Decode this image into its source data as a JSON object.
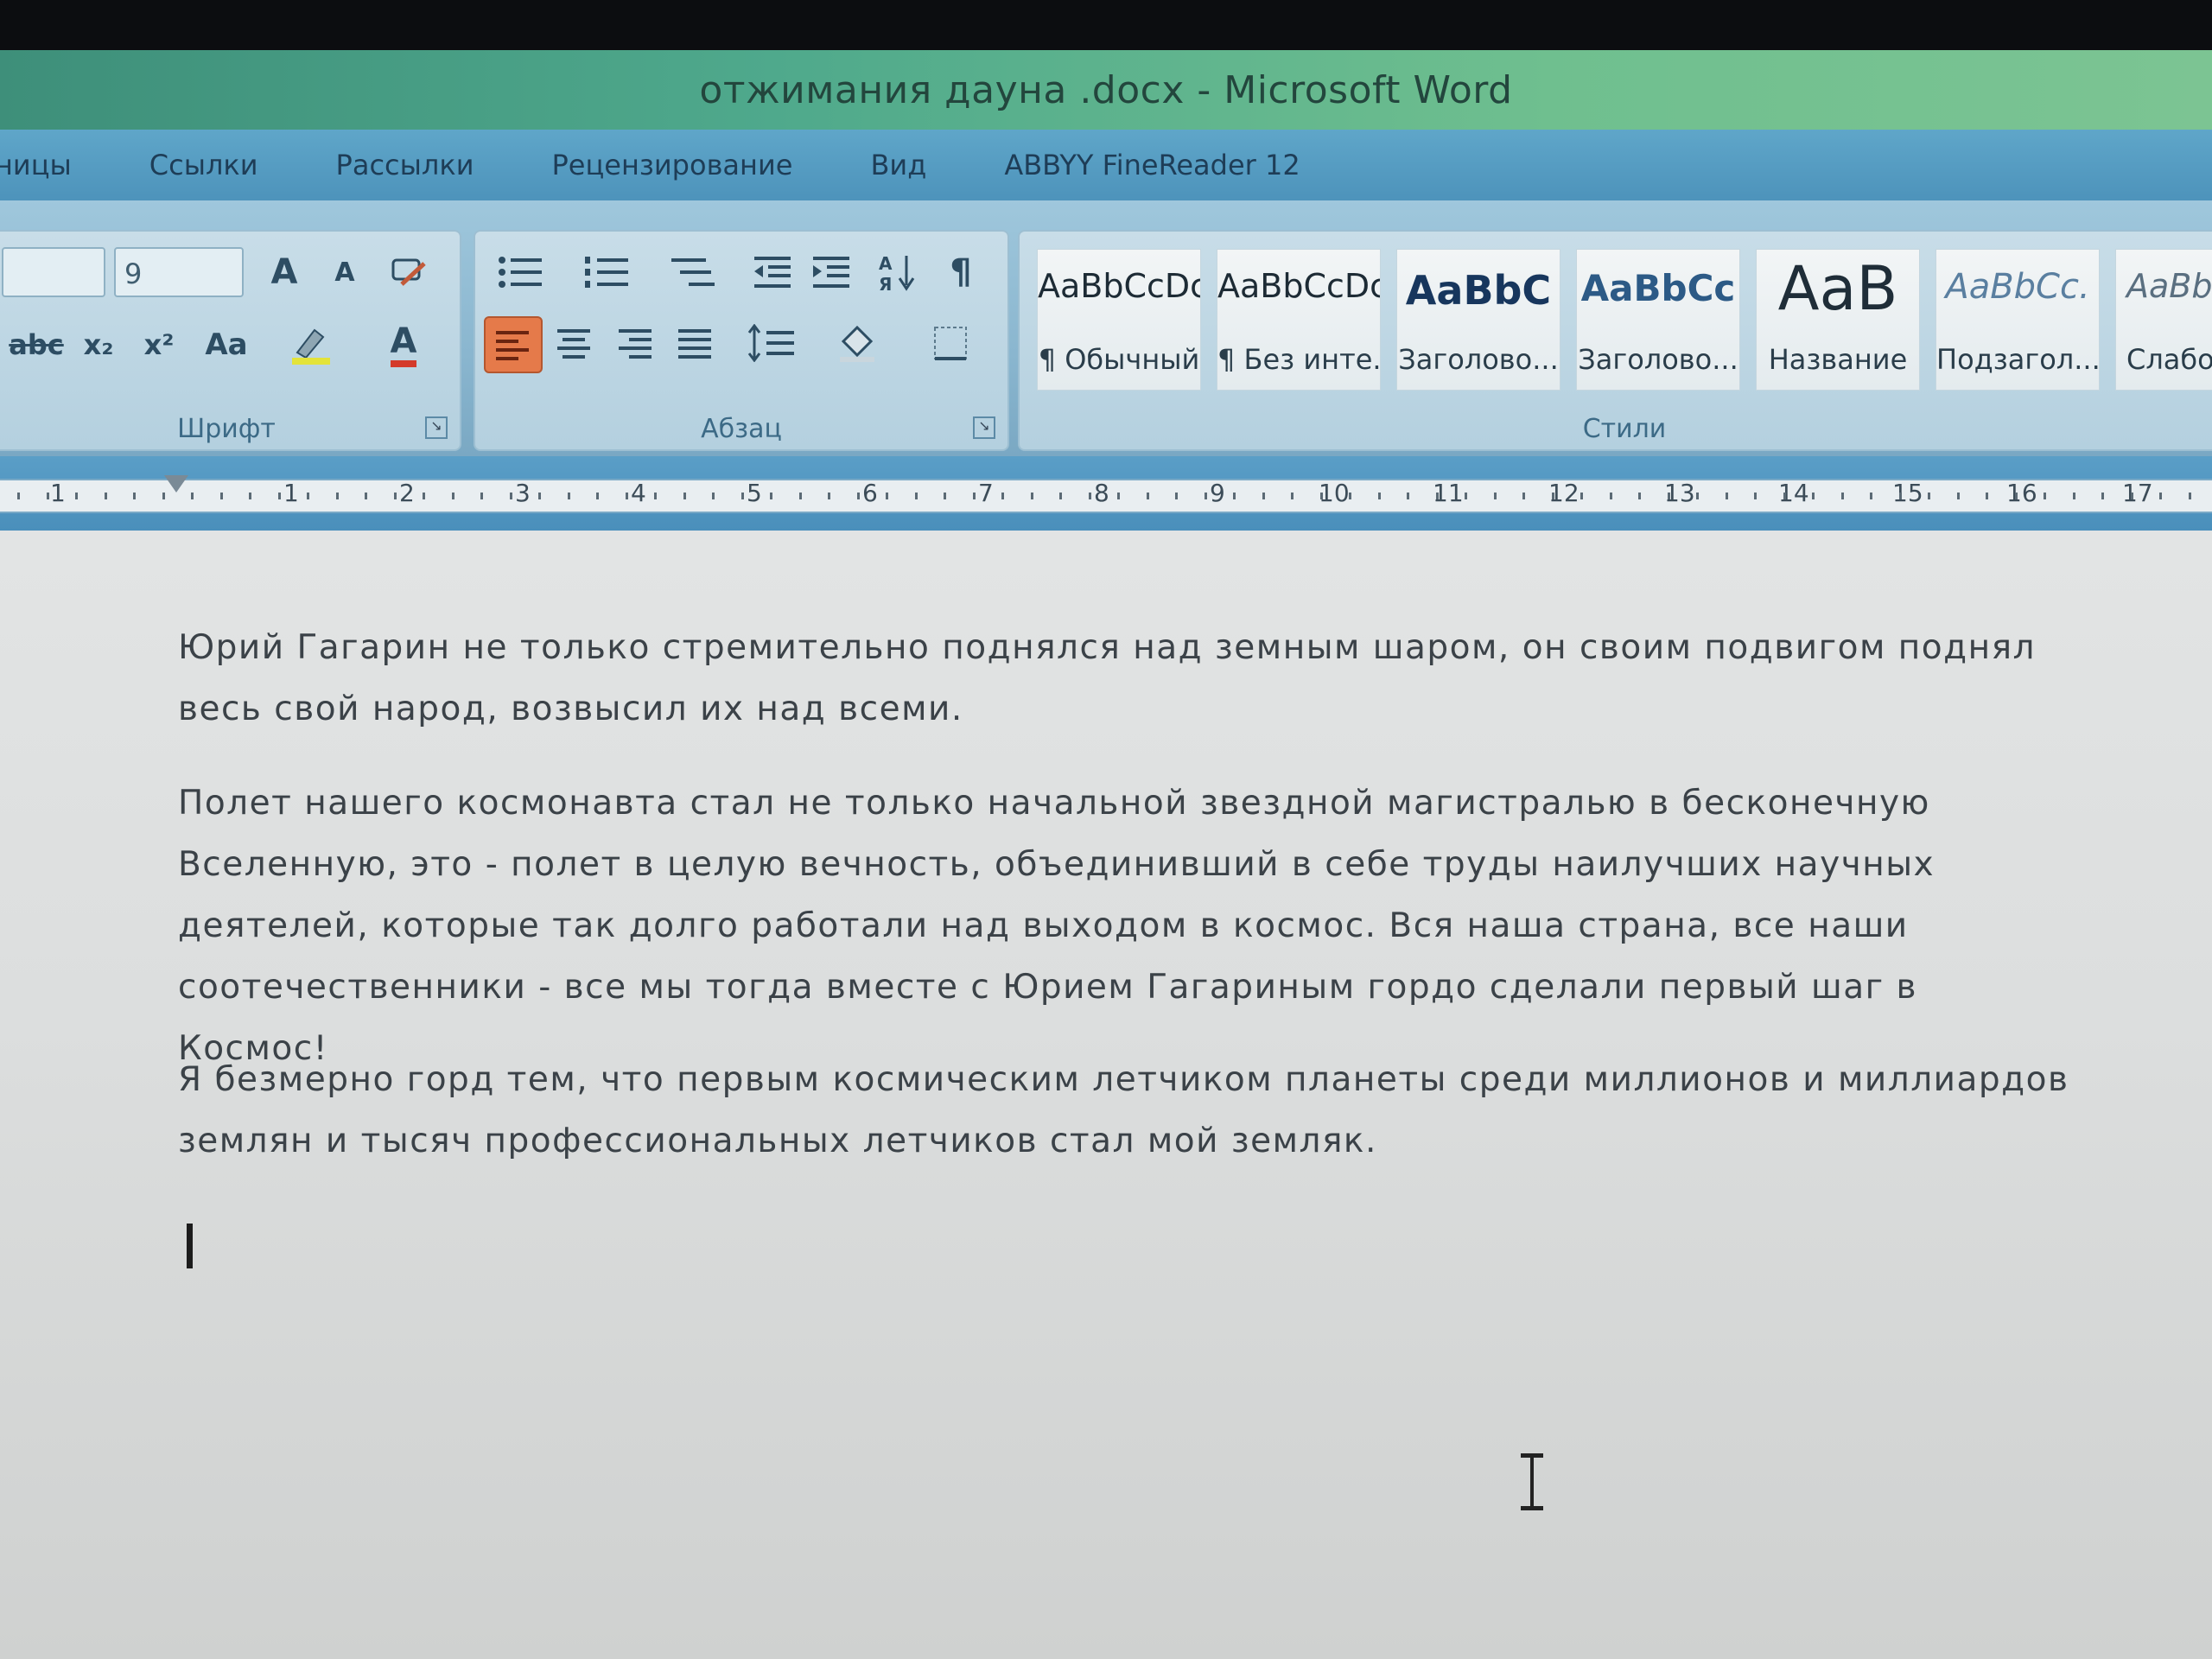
{
  "window": {
    "title": "отжимания дауна .docx - Microsoft Word"
  },
  "tabs": [
    "ницы",
    "Ссылки",
    "Рассылки",
    "Рецензирование",
    "Вид",
    "ABBYY FineReader 12"
  ],
  "ribbon": {
    "font": {
      "label": "Шрифт",
      "size_value": "9",
      "grow_glyph": "A",
      "shrink_glyph": "A",
      "strike_glyph": "abc",
      "subscript_glyph": "x₂",
      "superscript_glyph": "x²",
      "case_glyph": "Aa",
      "color_glyph": "A"
    },
    "paragraph": {
      "label": "Абзац",
      "pilcrow": "¶"
    },
    "styles": {
      "label": "Стили",
      "items": [
        {
          "sample": "AaBbCcDc",
          "name": "¶ Обычный"
        },
        {
          "sample": "AaBbCcDc",
          "name": "¶ Без инте..."
        },
        {
          "sample": "AaBbC",
          "name": "Заголово..."
        },
        {
          "sample": "AaBbCc",
          "name": "Заголово..."
        },
        {
          "sample": "AaB",
          "name": "Название"
        },
        {
          "sample": "AaBbCc.",
          "name": "Подзагол..."
        },
        {
          "sample": "AaBb",
          "name": "Слабо"
        }
      ]
    }
  },
  "ruler": {
    "numbers": [
      "1",
      "1",
      "2",
      "3",
      "4",
      "5",
      "6",
      "7",
      "8",
      "9",
      "10",
      "11",
      "12",
      "13",
      "14",
      "15",
      "16",
      "17"
    ]
  },
  "document": {
    "paragraphs": [
      "Юрий Гагарин не только стремительно поднялся над земным шаром, он своим подвигом поднял весь свой народ, возвысил их над всеми.",
      "Полет нашего космонавта стал не только начальной звездной магистралью в бесконечную Вселенную, это - полет в целую вечность, объединивший в себе труды наилучших научных деятелей, которые так долго работали над выходом в космос. Вся наша страна, все наши соотечественники - все мы тогда вместе с Юрием Гагариным гордо сделали первый шаг в Космос!",
      "Я безмерно горд тем, что первым космическим летчиком планеты среди миллионов и миллиардов землян и тысяч профессиональных летчиков стал мой земляк."
    ]
  }
}
